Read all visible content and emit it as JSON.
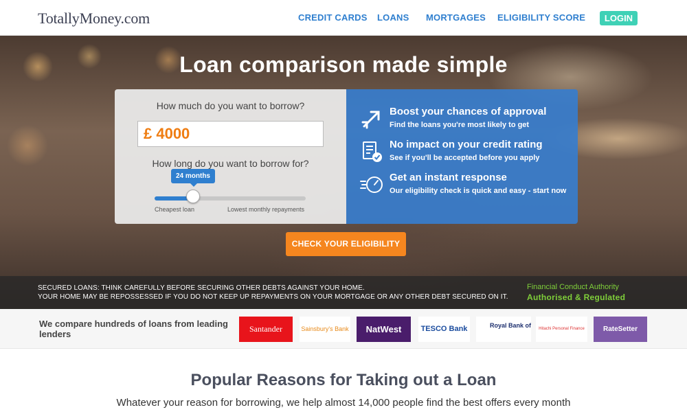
{
  "header": {
    "logo": "TotallyMoney.com",
    "nav": [
      "CREDIT CARDS",
      "LOANS",
      "MORTGAGES",
      "ELIGIBILITY SCORE"
    ],
    "login_label": "LOGIN"
  },
  "hero": {
    "title": "Loan comparison made simple",
    "form": {
      "amount_question": "How much do you want to borrow?",
      "amount_value": "£ 4000",
      "term_question": "How long do you want to borrow for?",
      "term_value": "24 months",
      "term_slider_fraction": 0.25,
      "slider_left_label": "Cheapest loan",
      "slider_right_label": "Lowest monthly repayments"
    },
    "benefits": [
      {
        "icon": "rocket-icon",
        "title": "Boost your chances of approval",
        "subtitle": "Find the loans you're most likely to get"
      },
      {
        "icon": "document-check-icon",
        "title": "No impact on your credit rating",
        "subtitle": "See if you'll be accepted before you apply"
      },
      {
        "icon": "speedometer-icon",
        "title": "Get an instant response",
        "subtitle": "Our eligibility check is quick and easy - start now"
      }
    ],
    "cta_label": "CHECK YOUR ELIGIBILITY",
    "warning_line1": "SECURED LOANS: THINK CAREFULLY BEFORE SECURING OTHER DEBTS AGAINST YOUR HOME.",
    "warning_line2": "YOUR HOME MAY BE REPOSSESSED IF YOU DO NOT KEEP UP REPAYMENTS ON YOUR MORTGAGE OR ANY OTHER DEBT SECURED ON IT.",
    "fca_line1": "Financial Conduct Authority",
    "fca_line2": "Authorised & Regulated"
  },
  "lenders": {
    "intro": "We compare hundreds of loans from leading lenders",
    "logos": [
      "Santander",
      "Sainsbury's Bank",
      "NatWest",
      "TESCO Bank",
      "Royal Bank of Scotland",
      "Hitachi Personal Finance",
      "RateSetter"
    ]
  },
  "reasons": {
    "title": "Popular Reasons for Taking out a Loan",
    "subtitle": "Whatever your reason for borrowing, we help almost 14,000 people find the best offers every month"
  },
  "colors": {
    "nav_blue": "#2f7fcf",
    "login_teal": "#3fd1b6",
    "cta_orange": "#f5861f",
    "amount_orange": "#ef7d12",
    "fca_green": "#7fcf3a"
  }
}
